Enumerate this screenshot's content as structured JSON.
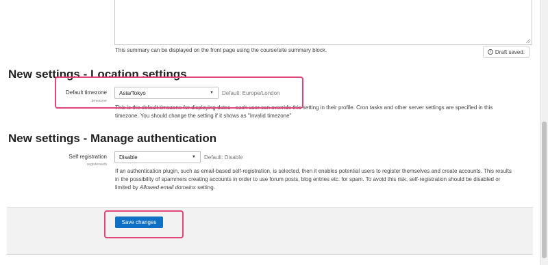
{
  "summary": {
    "help_text": "This summary can be displayed on the front page using the course/site summary block.",
    "draft_status": "Draft saved.",
    "info_icon": "i"
  },
  "location": {
    "heading": "New settings - Location settings",
    "timezone": {
      "label": "Default timezone",
      "sublabel": "timezone",
      "value": "Asia/Tokyo",
      "default_text": "Default: Europe/London",
      "desc_line1": "This is the default timezone for displaying dates - each user can override this setting in their profile. Cron tasks and other server settings are specified in this",
      "desc_line2": "timezone. You should change the setting if it shows as \"Invalid timezone\""
    }
  },
  "auth": {
    "heading": "New settings - Manage authentication",
    "registration": {
      "label": "Self registration",
      "sublabel": "registerauth",
      "value": "Disable",
      "default_text": "Default: Disable",
      "desc_line1": "If an authentication plugin, such as email-based self-registration, is selected, then it enables potential users to register themselves and create accounts. This results",
      "desc_line2": "in the possibility of spammers creating accounts in order to use forum posts, blog entries etc. for spam. To avoid this risk, self-registration should be disabled or",
      "desc_line3_pre": "limited by ",
      "desc_line3_em": "Allowed email domains",
      "desc_line3_post": " setting."
    }
  },
  "footer": {
    "save_label": "Save changes"
  },
  "colors": {
    "highlight": "#e0457b",
    "primary_button": "#0f6fc5"
  }
}
